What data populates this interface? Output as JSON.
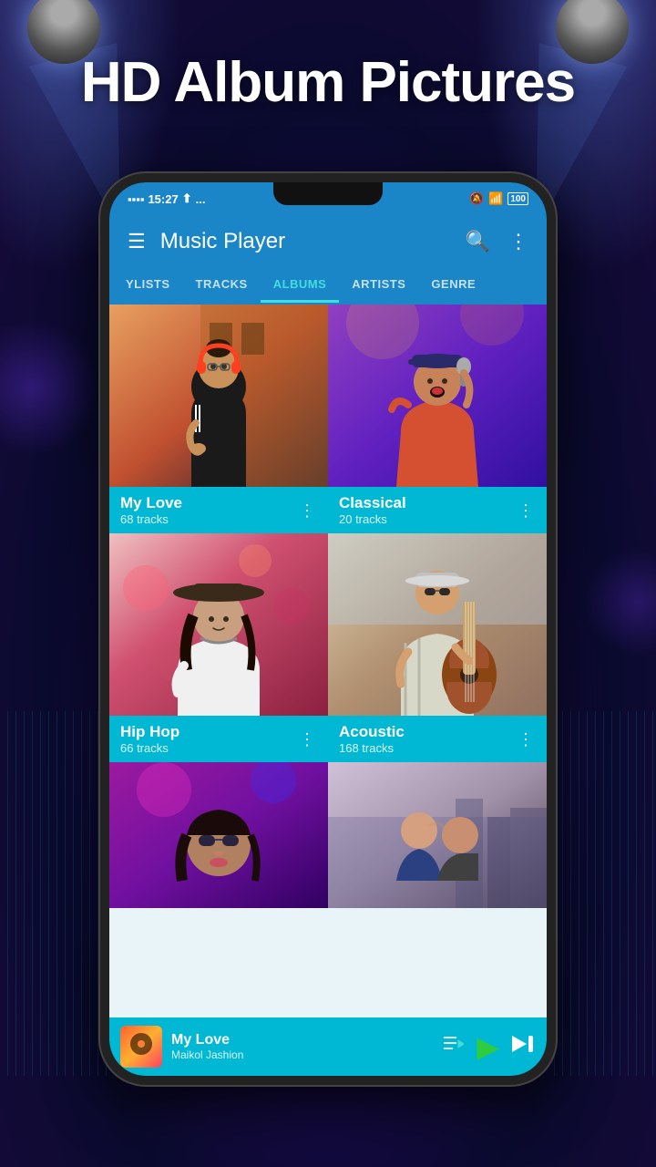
{
  "hero": {
    "title": "HD Album Pictures"
  },
  "statusBar": {
    "time": "15:27",
    "signal": "▲",
    "dots": "...",
    "battery": "100"
  },
  "header": {
    "title": "Music Player",
    "menuLabel": "☰",
    "searchLabel": "🔍",
    "moreLabel": "⋮"
  },
  "tabs": [
    {
      "label": "YLISTS",
      "active": false
    },
    {
      "label": "TRACKS",
      "active": false
    },
    {
      "label": "ALBUMS",
      "active": true
    },
    {
      "label": "ARTISTS",
      "active": false
    },
    {
      "label": "GENRE",
      "active": false
    }
  ],
  "albums": [
    {
      "name": "My Love",
      "tracks": "68 tracks",
      "color1": "#e8a060",
      "color2": "#c0522a"
    },
    {
      "name": "Classical",
      "tracks": "20 tracks",
      "color1": "#7030a0",
      "color2": "#3010a0"
    },
    {
      "name": "Hip Hop",
      "tracks": "66 tracks",
      "color1": "#d4587a",
      "color2": "#8b2040"
    },
    {
      "name": "Acoustic",
      "tracks": "168 tracks",
      "color1": "#c8b090",
      "color2": "#906050"
    }
  ],
  "partialAlbums": [
    {
      "color1": "#9b1aa0",
      "color2": "#300060"
    },
    {
      "color1": "#c0b0d0",
      "color2": "#504050"
    }
  ],
  "player": {
    "title": "My Love",
    "artist": "Maikol Jashion",
    "playlistIcon": "≡",
    "playIcon": "▶",
    "nextIcon": "⏭"
  }
}
